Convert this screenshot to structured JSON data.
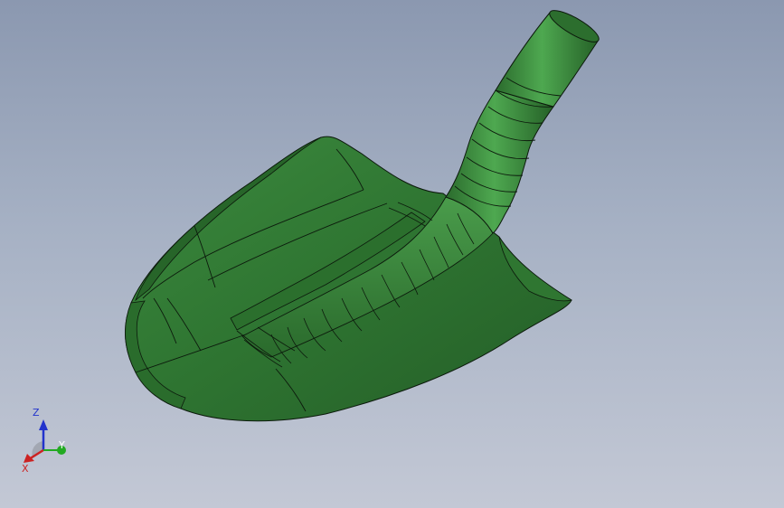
{
  "viewport": {
    "background_top": "#8b98b0",
    "background_bottom": "#c3c8d5"
  },
  "model": {
    "part": "shovel",
    "color": "#2f7a34",
    "edge_color": "#0c1a0c"
  },
  "triad": {
    "z_label": "Z",
    "x_label": "X",
    "y_label": "Y",
    "z_color": "#2233cc",
    "x_color": "#cc2222",
    "y_color": "#22aa22"
  }
}
